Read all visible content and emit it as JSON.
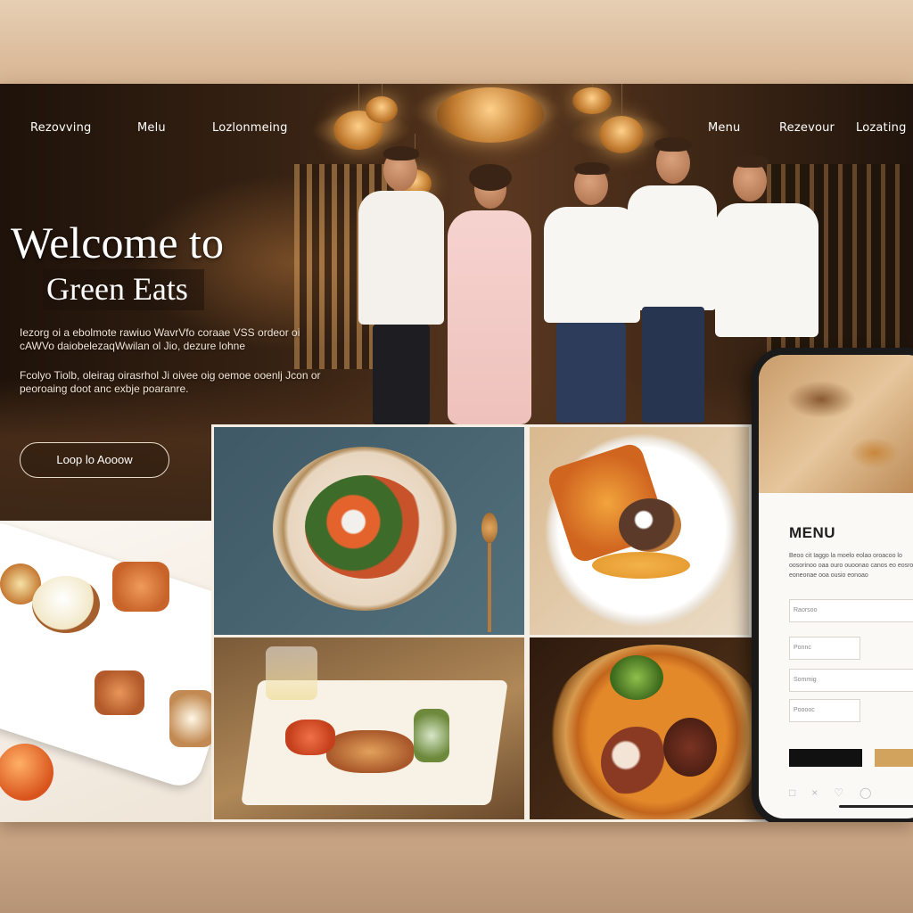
{
  "nav": {
    "left": [
      "Rezovving",
      "Melu",
      "Lozlonmeing"
    ],
    "right": [
      "Menu",
      "Rezevour",
      "Lozating"
    ]
  },
  "hero": {
    "title": "Welcome to",
    "subtitle": "Green Eats",
    "paragraph1": "Iezorg oi a ebolmote rawiuo WavrVfo coraae VSS ordeor oi cAWVo daiobelezaqWwilan ol Jio, dezure lohne",
    "paragraph2": "Fcolyo Tiolb, oleirag oirasrhol Ji oivee oig oemoe ooenlj Jcon or peoroaing doot anc exbje poaranre.",
    "cta_label": "Loop lo Aooow"
  },
  "phone": {
    "menu_title": "MENU",
    "menu_text": "Beoo cit Iaggo la moelo eolao oroacoo lo oosorinoo oaa ouro ouoonao canos eo eosrooe eoneonae ooa ousio eonoao",
    "fields": [
      "Raorsoo",
      "Ponnc",
      "Sommig",
      "Pooooc"
    ],
    "icons": [
      "phone-icon",
      "close-icon",
      "heart-icon",
      "cart-icon"
    ],
    "colors": {
      "dark_button": "#111111",
      "gold_button": "#d2a35c"
    }
  }
}
